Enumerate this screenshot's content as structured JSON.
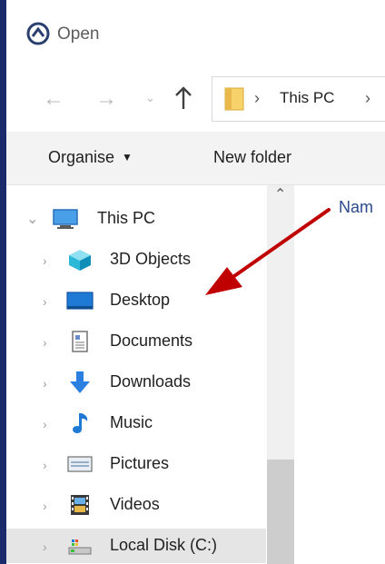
{
  "window": {
    "title": "Open"
  },
  "nav": {
    "back_glyph": "←",
    "forward_glyph": "→",
    "recent_glyph": "⌄"
  },
  "address": {
    "separator": "›",
    "crumbs": [
      "This PC"
    ]
  },
  "toolbar": {
    "organise_label": "Organise",
    "organise_caret": "▼",
    "new_folder_label": "New folder"
  },
  "tree": {
    "root": {
      "label": "This PC",
      "icon": "computer-icon"
    },
    "items": [
      {
        "label": "3D Objects",
        "icon": "3d-objects-icon"
      },
      {
        "label": "Desktop",
        "icon": "desktop-icon"
      },
      {
        "label": "Documents",
        "icon": "documents-icon"
      },
      {
        "label": "Downloads",
        "icon": "downloads-icon"
      },
      {
        "label": "Music",
        "icon": "music-icon"
      },
      {
        "label": "Pictures",
        "icon": "pictures-icon"
      },
      {
        "label": "Videos",
        "icon": "videos-icon"
      },
      {
        "label": "Local Disk (C:)",
        "icon": "local-disk-icon",
        "selected": true
      }
    ]
  },
  "content": {
    "column_header": "Nam"
  },
  "colors": {
    "annotation_arrow": "#c00000",
    "accent": "#2b4a8c",
    "folder": "#f5c542"
  }
}
